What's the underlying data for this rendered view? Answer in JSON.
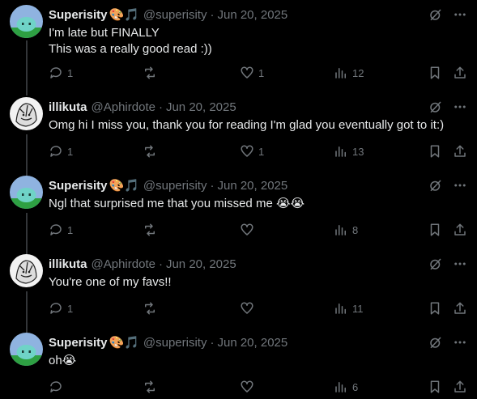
{
  "thread": [
    {
      "author": "Superisity",
      "author_emoji": "🎨🎵",
      "handle": "@superisity",
      "date": "Jun 20, 2025",
      "text": "I'm late but FINALLY\nThis was a really good read :))",
      "replies": "1",
      "reposts": "",
      "likes": "1",
      "views": "12",
      "avatar": "slime"
    },
    {
      "author": "illikuta",
      "author_emoji": "",
      "handle": "@Aphirdote",
      "date": "Jun 20, 2025",
      "text": "Omg hi I miss you, thank you for reading I'm glad you eventually got to it:)",
      "replies": "1",
      "reposts": "",
      "likes": "1",
      "views": "13",
      "avatar": "sketch"
    },
    {
      "author": "Superisity",
      "author_emoji": "🎨🎵",
      "handle": "@superisity",
      "date": "Jun 20, 2025",
      "text": "Ngl that surprised me that you missed me 😭😭",
      "replies": "1",
      "reposts": "",
      "likes": "",
      "views": "8",
      "avatar": "slime"
    },
    {
      "author": "illikuta",
      "author_emoji": "",
      "handle": "@Aphirdote",
      "date": "Jun 20, 2025",
      "text": "You're one of my favs!!",
      "replies": "1",
      "reposts": "",
      "likes": "",
      "views": "11",
      "avatar": "sketch"
    },
    {
      "author": "Superisity",
      "author_emoji": "🎨🎵",
      "handle": "@superisity",
      "date": "Jun 20, 2025",
      "text": "oh😭",
      "replies": "",
      "reposts": "",
      "likes": "",
      "views": "6",
      "avatar": "slime"
    }
  ],
  "separator": "·",
  "icons": {
    "grok": "grok-icon",
    "more": "more-icon",
    "reply": "reply-icon",
    "repost": "repost-icon",
    "like": "like-icon",
    "views": "views-icon",
    "bookmark": "bookmark-icon",
    "share": "share-icon"
  },
  "colors": {
    "background": "#000000",
    "text": "#e7e9ea",
    "muted": "#71767b",
    "thread_line": "#333639",
    "avatar_sky": "#8fb3e0",
    "avatar_grass": "#2ea043",
    "slime": "#6fd3c7"
  }
}
